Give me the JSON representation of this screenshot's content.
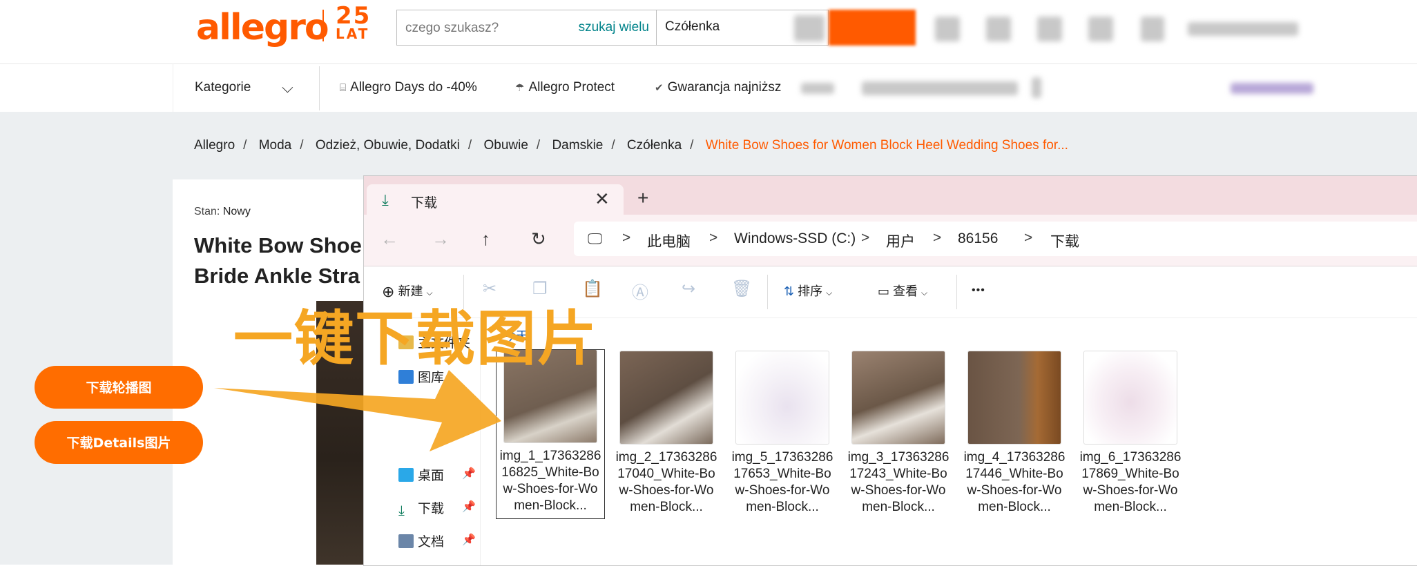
{
  "header": {
    "logo": "allegro",
    "logo_badge_number": "25",
    "logo_badge_text": "LAT",
    "search_placeholder": "czego szukasz?",
    "search_many_label": "szukaj wielu",
    "category_value": "Czółenka",
    "accent_color": "#ff5a00"
  },
  "nav": {
    "categories_label": "Kategorie",
    "links": [
      {
        "icon": "percent-tag-icon",
        "label": "Allegro Days do -40%"
      },
      {
        "icon": "umbrella-icon",
        "label": "Allegro Protect"
      },
      {
        "icon": "badge-check-icon",
        "label": "Gwarancja najniższ"
      }
    ]
  },
  "breadcrumb": {
    "items": [
      "Allegro",
      "Moda",
      "Odzież, Obuwie, Dodatki",
      "Obuwie",
      "Damskie",
      "Czółenka"
    ],
    "current": "White Bow Shoes for Women Block Heel Wedding Shoes for..."
  },
  "product": {
    "condition_label": "Stan:",
    "condition_value": "Nowy",
    "title_line1": "White Bow Shoe",
    "title_line2": "Bride Ankle Stra"
  },
  "explorer": {
    "tab_label": "下载",
    "address": [
      "此电脑",
      "Windows-SSD (C:)",
      "用户",
      "86156",
      "下载"
    ],
    "toolbar": {
      "new_label": "新建",
      "sort_label": "排序",
      "view_label": "查看",
      "more_label": "•••"
    },
    "nav_pane": [
      {
        "label": "主文件夹",
        "pinned": false
      },
      {
        "label": "图库",
        "pinned": false
      },
      {
        "label": "桌面",
        "pinned": true
      },
      {
        "label": "下载",
        "pinned": true
      },
      {
        "label": "文档",
        "pinned": true
      }
    ],
    "group_label": "今天",
    "files": [
      {
        "name": "img_1_1736328616825_White-Bow-Shoes-for-Women-Block...",
        "selected": true
      },
      {
        "name": "img_2_1736328617040_White-Bow-Shoes-for-Women-Block...",
        "selected": false
      },
      {
        "name": "img_5_1736328617653_White-Bow-Shoes-for-Women-Block...",
        "selected": false
      },
      {
        "name": "img_3_1736328617243_White-Bow-Shoes-for-Women-Block...",
        "selected": false
      },
      {
        "name": "img_4_1736328617446_White-Bow-Shoes-for-Women-Block...",
        "selected": false
      },
      {
        "name": "img_6_1736328617869_White-Bow-Shoes-for-Women-Block...",
        "selected": false
      }
    ]
  },
  "overlay": {
    "title": "一键下载图片",
    "btn_carousel": "下载轮播图",
    "btn_details": "下载Details图片",
    "highlight_color": "#f5a623"
  }
}
